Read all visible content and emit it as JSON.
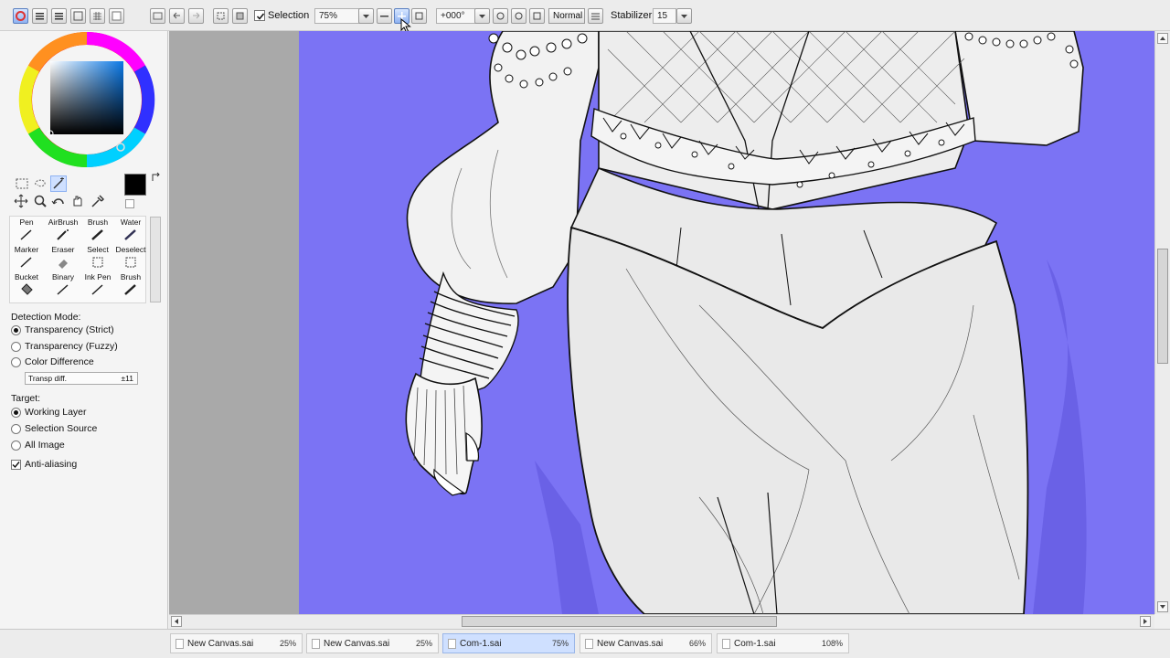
{
  "toolbar": {
    "selection_label": "Selection",
    "zoom_value": "75%",
    "rotation_value": "+000°",
    "blend_mode": "Normal",
    "stabilizer_label": "Stabilizer",
    "stabilizer_value": "15"
  },
  "tools": {
    "row1": [
      "Pen",
      "AirBrush",
      "Brush",
      "Water"
    ],
    "row2": [
      "Marker",
      "Eraser",
      "Select",
      "Deselect"
    ],
    "row3": [
      "Bucket",
      "Binary",
      "Ink Pen",
      "Brush"
    ]
  },
  "options": {
    "detection_mode_label": "Detection Mode:",
    "detection_options": [
      "Transparency (Strict)",
      "Transparency (Fuzzy)",
      "Color Difference"
    ],
    "transp_diff_label": "Transp diff.",
    "transp_diff_value": "±11",
    "target_label": "Target:",
    "target_options": [
      "Working Layer",
      "Selection Source",
      "All Image"
    ],
    "anti_aliasing_label": "Anti-aliasing"
  },
  "colors": {
    "canvas_bg": "#7b73f4",
    "canvas_dark": "#6a61e6",
    "gray_area": "#a9a9a9",
    "primary_color": "#000000"
  },
  "doc_tabs": [
    {
      "name": "New Canvas.sai",
      "zoom": "25%"
    },
    {
      "name": "New Canvas.sai",
      "zoom": "25%"
    },
    {
      "name": "Com-1.sai",
      "zoom": "75%"
    },
    {
      "name": "New Canvas.sai",
      "zoom": "66%"
    },
    {
      "name": "Com-1.sai",
      "zoom": "108%"
    }
  ]
}
